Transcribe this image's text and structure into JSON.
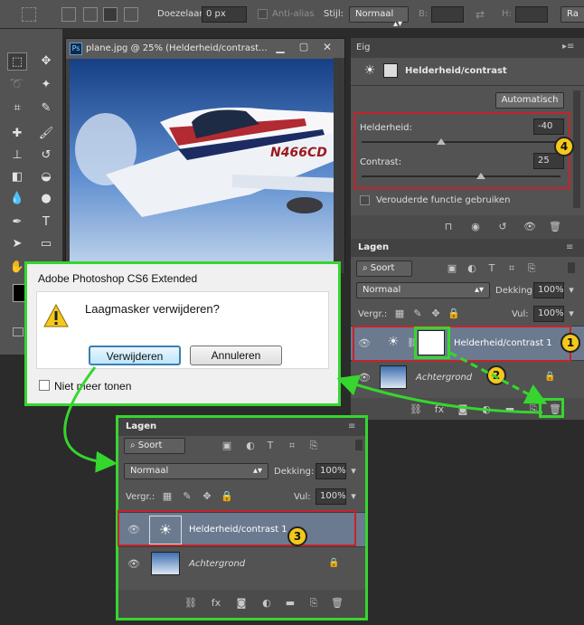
{
  "options_bar": {
    "feather_label": "Doezelaar:",
    "feather_value": "0 px",
    "antialias_label": "Anti-alias",
    "style_label": "Stijl:",
    "style_value": "Normaal",
    "width_label": "B:",
    "height_label": "H:",
    "refine_label": "Ra"
  },
  "document": {
    "title": "plane.jpg @ 25% (Helderheid/contrast...",
    "ps_icon": "Ps",
    "tail_number": "N466CD"
  },
  "properties": {
    "tab": "Eig",
    "title": "Helderheid/contrast",
    "auto_button": "Automatisch",
    "brightness_label": "Helderheid:",
    "brightness_value": "-40",
    "brightness_fraction": 0.4,
    "contrast_label": "Contrast:",
    "contrast_value": "25",
    "contrast_fraction": 0.6,
    "legacy_label": "Verouderde functie gebruiken"
  },
  "layers_top": {
    "title": "Lagen",
    "filter": "Soort",
    "blend": "Normaal",
    "opacity_label": "Dekking:",
    "opacity_value": "100%",
    "lock_label": "Vergr.:",
    "fill_label": "Vul:",
    "fill_value": "100%",
    "layer1": "Helderheid/contrast 1",
    "layer2": "Achtergrond"
  },
  "layers_bottom": {
    "title": "Lagen",
    "filter": "Soort",
    "blend": "Normaal",
    "opacity_label": "Dekking:",
    "opacity_value": "100%",
    "lock_label": "Vergr.:",
    "fill_label": "Vul:",
    "fill_value": "100%",
    "layer1": "Helderheid/contrast 1",
    "layer2": "Achtergrond"
  },
  "dialog": {
    "title": "Adobe Photoshop CS6 Extended",
    "message": "Laagmasker verwijderen?",
    "ok": "Verwijderen",
    "cancel": "Annuleren",
    "dont_show": "Niet meer tonen"
  },
  "badges": [
    "1",
    "2",
    "3",
    "4"
  ],
  "colors": {
    "highlight_red": "#c4242a",
    "highlight_green": "#36d62f",
    "badge": "#f4c91b"
  }
}
